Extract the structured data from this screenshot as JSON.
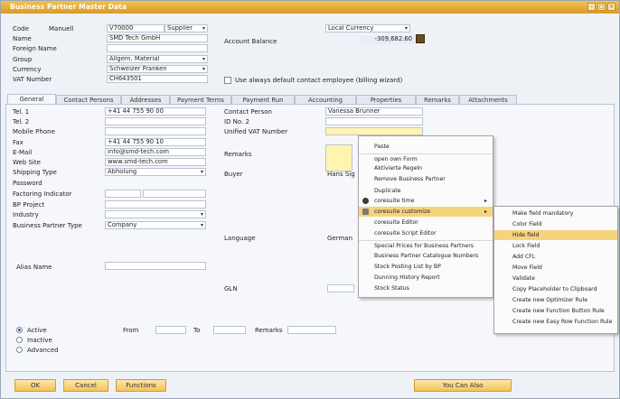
{
  "window": {
    "title": "Business Partner Master Data"
  },
  "header": {
    "code_label": "Code",
    "code_series": "Manuell",
    "code_value": "V70000",
    "bp_type": "Supplier",
    "name_label": "Name",
    "name_value": "SMD Tech GmbH",
    "foreign_name_label": "Foreign Name",
    "group_label": "Group",
    "group_value": "Allgem. Material",
    "currency_label": "Currency",
    "currency_value": "Schweizer Franken",
    "vat_label": "VAT Number",
    "vat_value": "CH643501",
    "local_currency": "Local Currency",
    "account_balance_label": "Account Balance",
    "account_balance_value": "-309,682.60",
    "default_contact_label": "Use always default contact employee (billing wizard)"
  },
  "tabs": [
    "General",
    "Contact Persons",
    "Addresses",
    "Payment Terms",
    "Payment Run",
    "Accounting",
    "Properties",
    "Remarks",
    "Attachments"
  ],
  "general_left": [
    {
      "label": "Tel. 1",
      "value": "+41 44 755 90 00"
    },
    {
      "label": "Tel. 2",
      "value": ""
    },
    {
      "label": "Mobile Phone",
      "value": ""
    },
    {
      "label": "Fax",
      "value": "+41 44 755 90 10"
    },
    {
      "label": "E-Mail",
      "value": "info@smd-tech.com"
    },
    {
      "label": "Web Site",
      "value": "www.smd-tech.com"
    },
    {
      "label": "Shipping Type",
      "value": "Abholung"
    },
    {
      "label": "Password",
      "value": ""
    },
    {
      "label": "Factoring Indicator",
      "value": ""
    },
    {
      "label": "BP Project",
      "value": ""
    },
    {
      "label": "Industry",
      "value": ""
    },
    {
      "label": "Business Partner Type",
      "value": "Company"
    }
  ],
  "general_right": {
    "contact_person_label": "Contact Person",
    "contact_person_value": "Vanessa Brunner",
    "id_no2_label": "ID No. 2",
    "unified_vat_label": "Unified VAT Number",
    "remarks_label": "Remarks",
    "buyer_label": "Buyer",
    "buyer_value": "Hans Sig",
    "language_label": "Language",
    "language_value": "German",
    "gln_label": "GLN"
  },
  "alias_name_label": "Alias Name",
  "status": {
    "active": "Active",
    "inactive": "Inactive",
    "advanced": "Advanced",
    "from_label": "From",
    "to_label": "To",
    "remarks_label": "Remarks"
  },
  "context_menu": [
    {
      "label": "Paste"
    },
    {
      "label": "open own Form"
    },
    {
      "label": "Aktivierte Regeln"
    },
    {
      "label": "Remove Business Partner"
    },
    {
      "label": "Duplicate"
    },
    {
      "label": "coresuite time",
      "submenu": true,
      "icon": "clock-icon"
    },
    {
      "label": "coresuite customize",
      "submenu": true,
      "icon": "customize-icon",
      "highlighted": true
    },
    {
      "label": "coresuite Editor"
    },
    {
      "label": "coresuite Script Editor"
    },
    {
      "label": "Special Prices for Business Partners"
    },
    {
      "label": "Business Partner Catalogue Numbers"
    },
    {
      "label": "Stock Posting List by BP"
    },
    {
      "label": "Dunning History Report"
    },
    {
      "label": "Stock Status"
    }
  ],
  "submenu": [
    {
      "label": "Make field mandatory"
    },
    {
      "label": "Color Field"
    },
    {
      "label": "Hide field",
      "highlighted": true
    },
    {
      "label": "Lock Field"
    },
    {
      "label": "Add CFL"
    },
    {
      "label": "Move Field"
    },
    {
      "label": "Validate"
    },
    {
      "label": "Copy Placeholder to Clipboard"
    },
    {
      "label": "Create new Optimizer Rule"
    },
    {
      "label": "Create new Function Button Rule"
    },
    {
      "label": "Create new Easy Row Function Rule"
    }
  ],
  "buttons": {
    "ok": "OK",
    "cancel": "Cancel",
    "functions": "Functions",
    "you_can_also": "You Can Also"
  },
  "colors": {
    "accent": "#f3c25a",
    "highlight": "#f6d37d",
    "mandatory_field": "#fff5b0"
  }
}
